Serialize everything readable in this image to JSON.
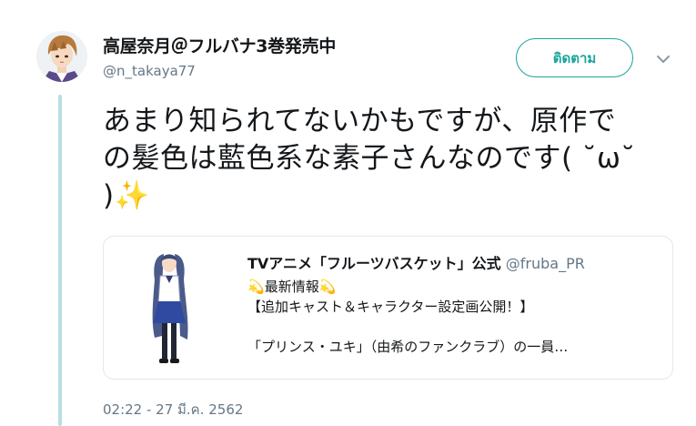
{
  "user": {
    "display_name": "高屋奈月＠フルバナ3巻発売中",
    "handle": "@n_takaya77"
  },
  "actions": {
    "follow_label": "ติดตาม"
  },
  "tweet": {
    "line1": "あまり知られてないかもですが、原作で",
    "line2": "の髪色は藍色系な素子さんなのです( ˘ω˘",
    "line3": ")",
    "line3_emoji": "✨",
    "timestamp": "02:22 - 27 มี.ค. 2562"
  },
  "quoted": {
    "name": "TVアニメ「フルーツバスケット」公式",
    "handle": "@fruba_PR",
    "emoji": "💫",
    "line1_text": "最新情報",
    "line2": "【追加キャスト＆キャラクター設定画公開！】",
    "line3": "「プリンス・ユキ」（由希のファンクラブ）の一員…"
  },
  "colors": {
    "accent": "#1aa59c",
    "thread_line": "#b7dfe1",
    "muted": "#657786"
  }
}
